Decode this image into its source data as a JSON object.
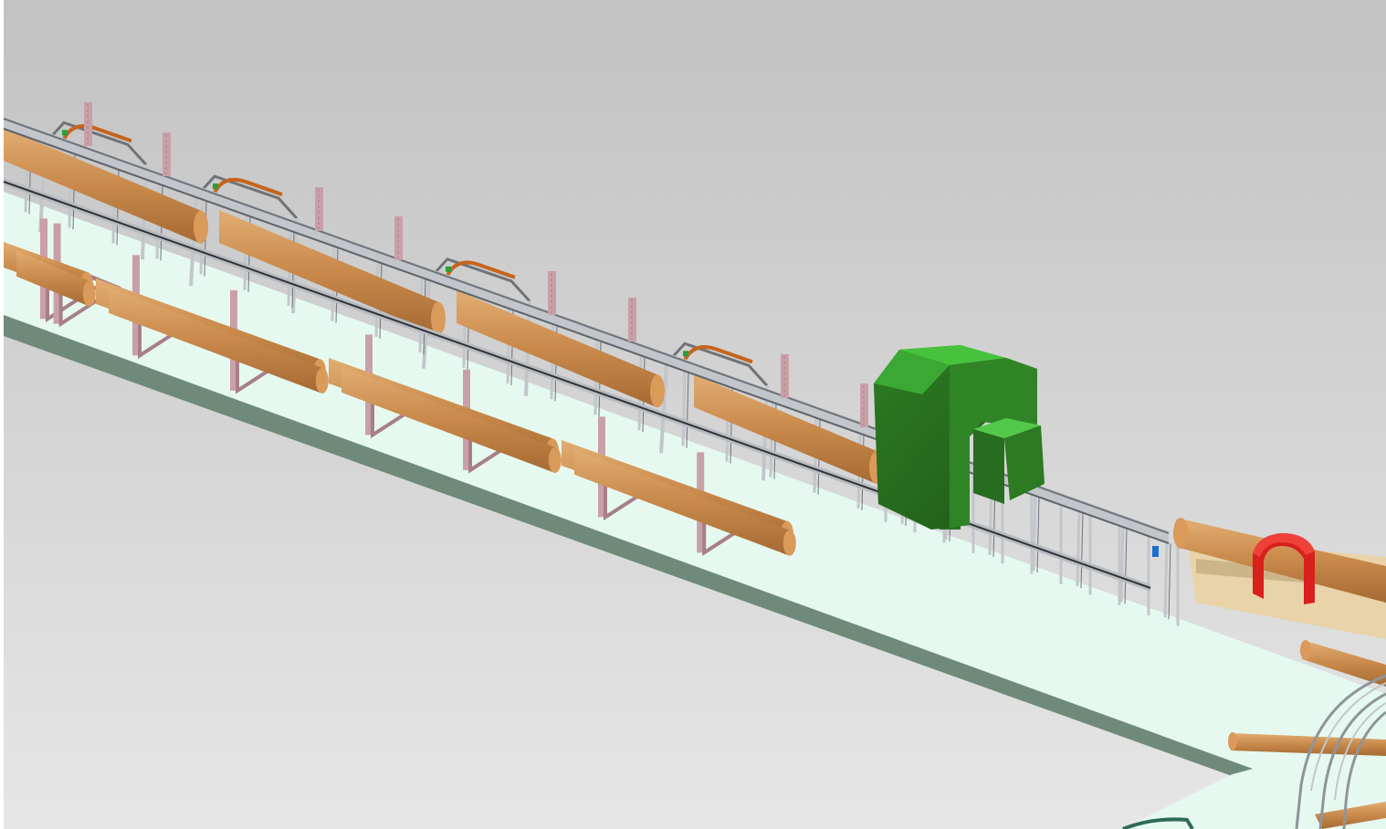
{
  "colors": {
    "sky_top": "#c2c2c2",
    "sky_bottom": "#e4e4e4",
    "floor": "#e6f9f0",
    "floor_edge": "#6f8a7a",
    "log": "#c8894a",
    "log_light": "#dca469",
    "log_end": "#d99a5a",
    "rack": "#c9a0a8",
    "rack_dark": "#a77f88",
    "steel": "#c2c6cb",
    "steel_dark": "#6e7378",
    "scanner_light": "#3fb53a",
    "scanner_dark": "#256a1e",
    "debarker_red": "#d8201d",
    "bracket_orange": "#c5651c",
    "deck_wood": "#e9d3a8"
  },
  "scene": {
    "main_objects": [
      "log-deck-racks",
      "log-conveyor",
      "scanner-housing",
      "debarker-ring",
      "curved-transfer-conveyor"
    ]
  }
}
